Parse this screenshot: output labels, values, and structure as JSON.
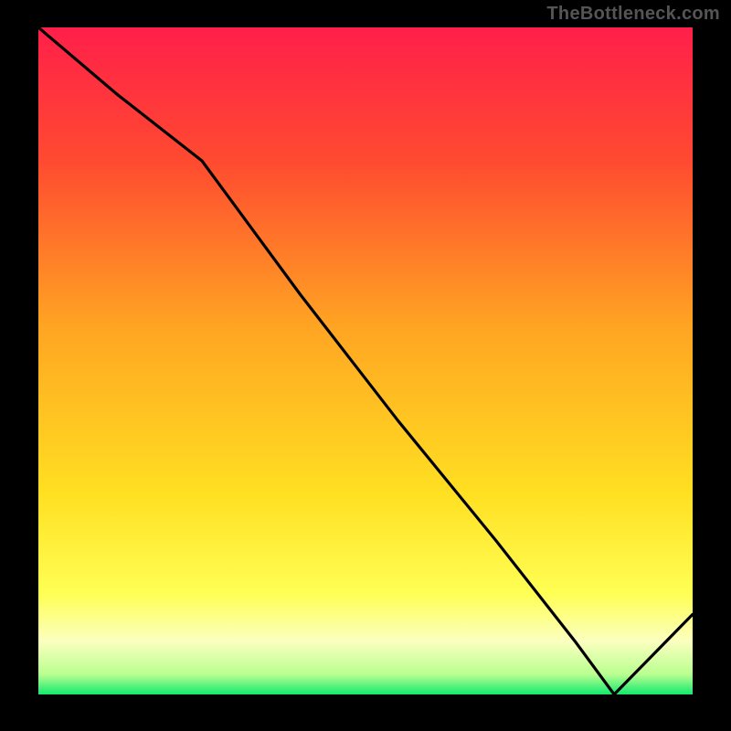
{
  "watermark": "TheBottleneck.com",
  "xlabel_text": "",
  "chart_data": {
    "type": "line",
    "title": "",
    "xlabel": "",
    "ylabel": "",
    "xlim": [
      0,
      100
    ],
    "ylim": [
      0,
      100
    ],
    "grid": false,
    "legend": false,
    "description": "Single black line on a vertical rainbow-gradient background (red at top through orange, yellow, to a thin green band at the bottom). The line starts at the top-left corner, descends with a slight curvature to roughly x≈25 y≈80, then falls nearly linearly to a minimum near x≈88 y≈0, then rises to roughly x=100 y≈12.",
    "series": [
      {
        "name": "curve",
        "x": [
          0,
          12,
          25,
          40,
          55,
          70,
          82,
          88,
          94,
          100
        ],
        "values": [
          100,
          90,
          80,
          60,
          41,
          23,
          8,
          0,
          6,
          12
        ]
      }
    ],
    "background_gradient_stops": [
      {
        "offset": 0.0,
        "color": "#ff1f4a"
      },
      {
        "offset": 0.2,
        "color": "#ff4a30"
      },
      {
        "offset": 0.45,
        "color": "#ffa522"
      },
      {
        "offset": 0.7,
        "color": "#ffe022"
      },
      {
        "offset": 0.85,
        "color": "#ffff55"
      },
      {
        "offset": 0.92,
        "color": "#fbffbf"
      },
      {
        "offset": 0.97,
        "color": "#b9ff90"
      },
      {
        "offset": 1.0,
        "color": "#12e86f"
      }
    ]
  }
}
